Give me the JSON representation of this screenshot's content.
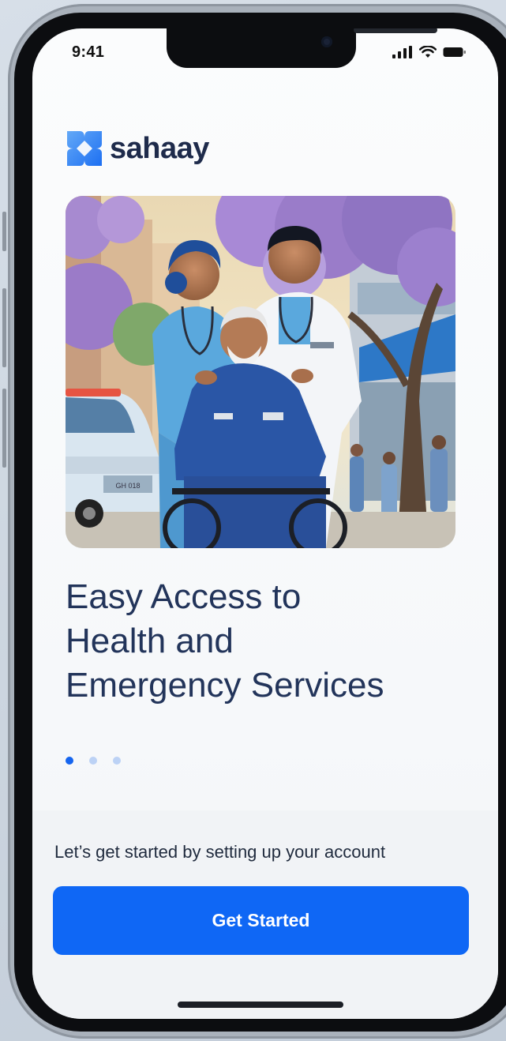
{
  "status_bar": {
    "time": "9:41",
    "icons": [
      "cellular-signal-icon",
      "wifi-icon",
      "battery-icon"
    ]
  },
  "brand": {
    "name": "sahaay",
    "logo_icon": "sahaay-logo-icon",
    "colors": {
      "logo_light": "#5aa0f5",
      "logo_dark": "#1565ef",
      "wordmark": "#1e2b4b"
    }
  },
  "hero": {
    "image_icon": "healthcare-workers-with-patient-illustration",
    "ambulance_plate": "GH 018"
  },
  "onboarding": {
    "headline": [
      "Easy Access to",
      "Health and",
      "Emergency Services"
    ],
    "page_count": 3,
    "active_page": 1
  },
  "footer": {
    "subtitle": "Let’s get started by setting up your account",
    "cta_label": "Get Started"
  },
  "colors": {
    "accent": "#0f67f5",
    "headline": "#22345a",
    "dot_active": "#1565ef",
    "dot_inactive": "#bcd2f5"
  }
}
